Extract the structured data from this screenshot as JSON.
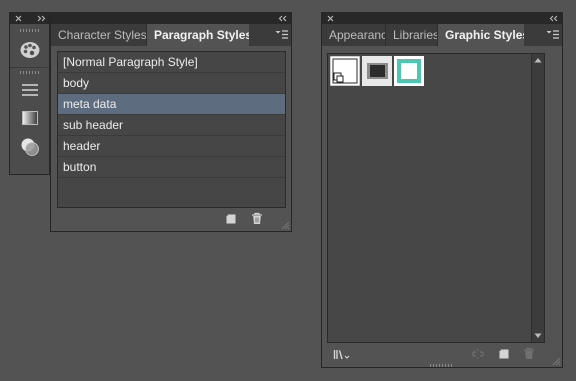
{
  "dock": {
    "tools": [
      "color-palette-icon",
      "align-lines-icon",
      "gradient-icon",
      "transparency-icon"
    ]
  },
  "paragraph_panel": {
    "tabs": [
      {
        "label": "Character Styles",
        "active": false
      },
      {
        "label": "Paragraph Styles",
        "active": true
      }
    ],
    "styles": [
      {
        "label": "[Normal Paragraph Style]",
        "selected": false
      },
      {
        "label": "body",
        "selected": false
      },
      {
        "label": "meta data",
        "selected": true
      },
      {
        "label": "sub header",
        "selected": false
      },
      {
        "label": "header",
        "selected": false
      },
      {
        "label": "button",
        "selected": false
      }
    ],
    "footer_icons": [
      "new-style-icon",
      "delete-style-icon"
    ]
  },
  "graphic_panel": {
    "tabs": [
      {
        "label": "Appearance",
        "active": false
      },
      {
        "label": "Libraries",
        "active": false
      },
      {
        "label": "Graphic Styles",
        "active": true
      }
    ],
    "swatches": [
      "default-style-swatch",
      "dark-inset-swatch",
      "teal-border-swatch"
    ],
    "footer_icons": [
      "libraries-menu-icon",
      "break-link-icon",
      "new-graphic-style-icon",
      "delete-graphic-style-icon"
    ]
  },
  "colors": {
    "background": "#535353",
    "selection": "#5e6c80",
    "teal": "#4dc6b3"
  }
}
